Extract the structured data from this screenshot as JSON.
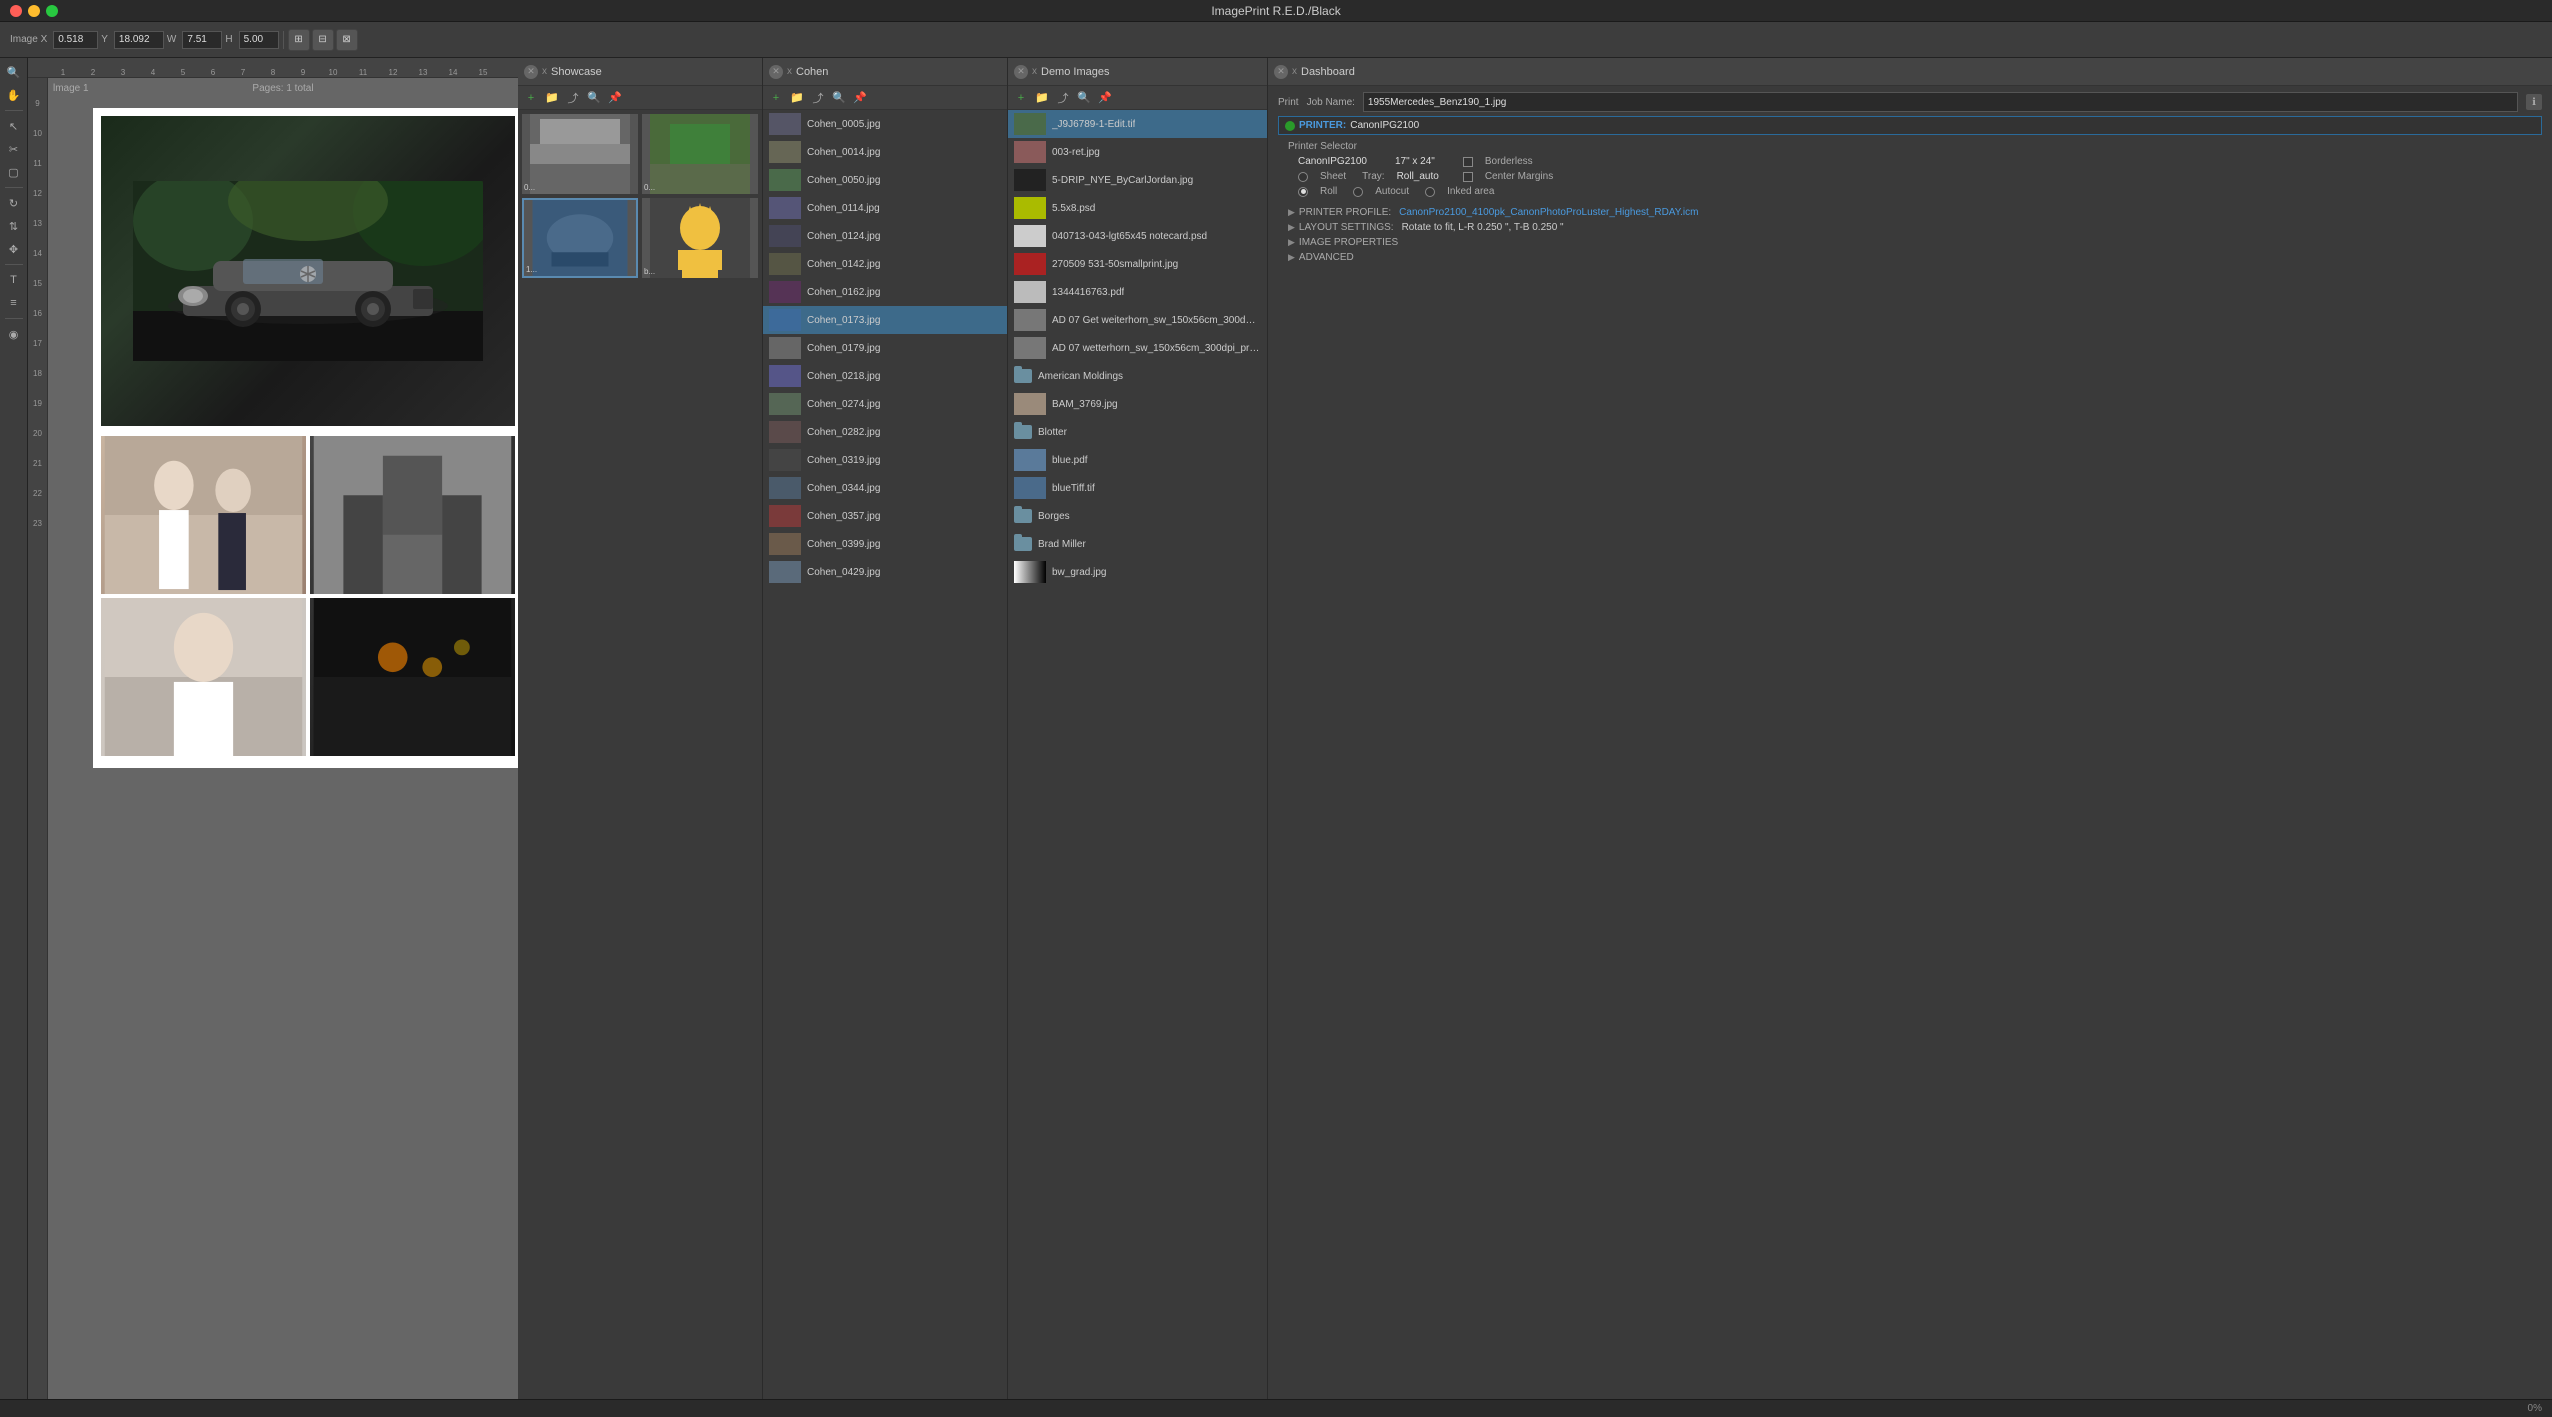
{
  "app": {
    "title": "ImagePrint R.E.D./Black"
  },
  "toolbar": {
    "image_label": "Image X",
    "x_value": "0.518",
    "y_label": "Y",
    "y_value": "18.092",
    "w_label": "W",
    "w_value": "7.51",
    "h_label": "H",
    "h_value": "5.00"
  },
  "canvas": {
    "page_label": "lmage 1",
    "pages_label": "Pages: 1 total"
  },
  "panels": [
    {
      "id": "showcase",
      "title": "Showcase",
      "files": [
        {
          "name": "0...",
          "type": "image"
        },
        {
          "name": "0...",
          "type": "image"
        },
        {
          "name": "b...",
          "type": "image"
        },
        {
          "name": "1...",
          "type": "image"
        }
      ]
    },
    {
      "id": "cohen",
      "title": "Cohen",
      "files": [
        {
          "name": "Cohen_0005.jpg",
          "type": "image"
        },
        {
          "name": "Cohen_0014.jpg",
          "type": "image"
        },
        {
          "name": "Cohen_0050.jpg",
          "type": "image"
        },
        {
          "name": "Cohen_0114.jpg",
          "type": "image"
        },
        {
          "name": "Cohen_0124.jpg",
          "type": "image"
        },
        {
          "name": "Cohen_0142.jpg",
          "type": "image"
        },
        {
          "name": "Cohen_0162.jpg",
          "type": "image"
        },
        {
          "name": "Cohen_0173.jpg",
          "type": "image",
          "selected": true
        },
        {
          "name": "Cohen_0179.jpg",
          "type": "image"
        },
        {
          "name": "Cohen_0218.jpg",
          "type": "image"
        },
        {
          "name": "Cohen_0274.jpg",
          "type": "image"
        },
        {
          "name": "Cohen_0282.jpg",
          "type": "image"
        },
        {
          "name": "Cohen_0319.jpg",
          "type": "image"
        },
        {
          "name": "Cohen_0344.jpg",
          "type": "image"
        },
        {
          "name": "Cohen_0357.jpg",
          "type": "image"
        },
        {
          "name": "Cohen_0399.jpg",
          "type": "image"
        },
        {
          "name": "Cohen_0429.jpg",
          "type": "image"
        }
      ]
    },
    {
      "id": "demo",
      "title": "Demo Images",
      "files": [
        {
          "name": "_J9J6789-1-Edit.tif",
          "type": "image",
          "selected": true
        },
        {
          "name": "003-ret.jpg",
          "type": "image"
        },
        {
          "name": "5-DRIP_NYE_ByCarlJordan.jpg",
          "type": "image"
        },
        {
          "name": "5.5x8.psd",
          "type": "image"
        },
        {
          "name": "040713-043-lgt65x45 notecard.psd",
          "type": "image"
        },
        {
          "name": "270509 531-50smallprint.jpg",
          "type": "image"
        },
        {
          "name": "1344416763.pdf",
          "type": "image"
        },
        {
          "name": "AD 07 Get weiterhorn_sw_150x56cm_300dpi_p...",
          "type": "image"
        },
        {
          "name": "AD 07 wetterhorn_sw_150x56cm_300dpi_print...",
          "type": "image"
        },
        {
          "name": "American Moldings",
          "type": "folder"
        },
        {
          "name": "BAM_3769.jpg",
          "type": "image"
        },
        {
          "name": "Blotter",
          "type": "folder"
        },
        {
          "name": "blue.pdf",
          "type": "image"
        },
        {
          "name": "blueTiff.tif",
          "type": "image"
        },
        {
          "name": "Borges",
          "type": "folder"
        },
        {
          "name": "Brad Miller",
          "type": "folder"
        },
        {
          "name": "bw_grad.jpg",
          "type": "image"
        }
      ]
    }
  ],
  "dashboard": {
    "title": "Dashboard",
    "print_label": "Print",
    "job_name_label": "Job Name:",
    "job_name_value": "1955Mercedes_Benz190_1.jpg",
    "printer_label": "PRINTER:",
    "printer_value": "CanonIPG2100",
    "printer_selector_label": "Printer Selector",
    "printer_name": "CanonIPG2100",
    "paper_size": "17\" x 24\"",
    "borderless_label": "Borderless",
    "tray_label": "Tray:",
    "tray_value": "Roll_auto",
    "center_margins_label": "Center Margins",
    "sheet_label": "Sheet",
    "roll_label": "Roll",
    "autocut_label": "Autocut",
    "inked_area_label": "Inked area",
    "profile_label": "PRINTER PROFILE:",
    "profile_value": "CanonPro2100_4100pk_CanonPhotoProLuster_Highest_RDAY.icm",
    "layout_label": "LAYOUT SETTINGS:",
    "layout_value": "Rotate to fit, L-R 0.250 \", T-B 0.250 \"",
    "image_properties_label": "IMAGE PROPERTIES",
    "advanced_label": "ADVANCED"
  },
  "statusbar": {
    "zoom": "0%"
  },
  "colors": {
    "selected_blue": "#3d6a8a",
    "accent_blue": "#4a9adf",
    "folder_blue": "#6a8fa0",
    "panel_bg": "#3a3a3a",
    "header_bg": "#444444"
  }
}
